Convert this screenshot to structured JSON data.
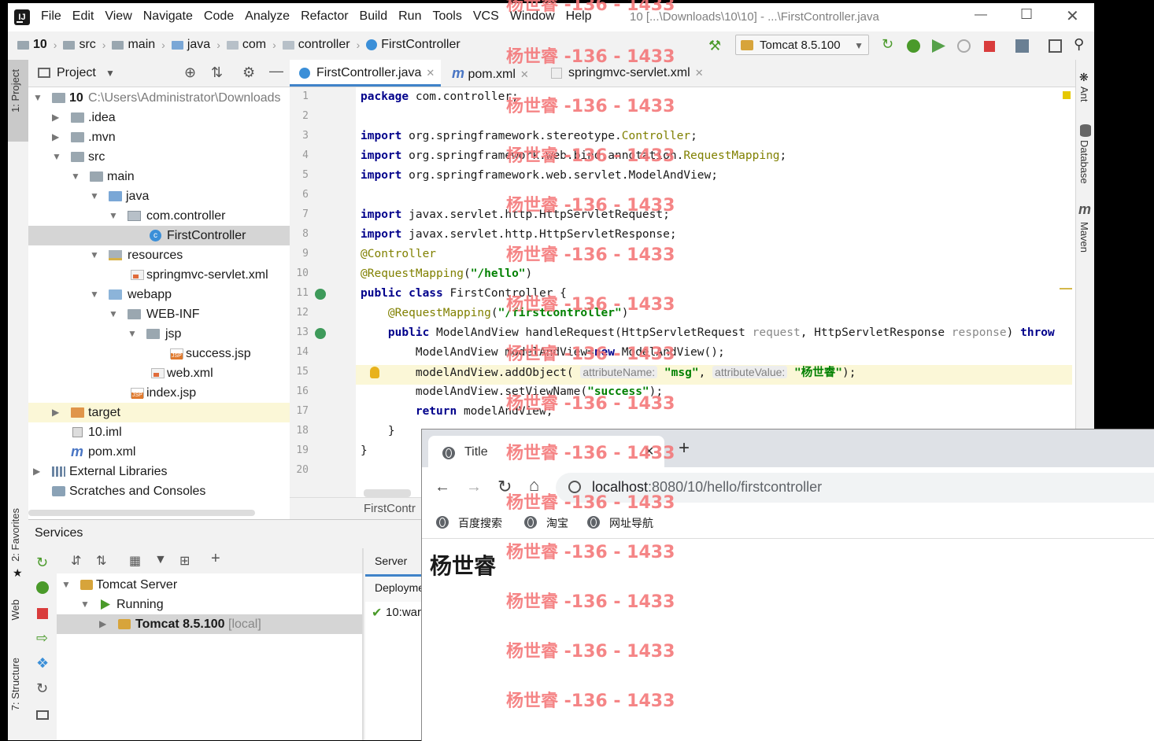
{
  "ide": {
    "menu": [
      "File",
      "Edit",
      "View",
      "Navigate",
      "Code",
      "Analyze",
      "Refactor",
      "Build",
      "Run",
      "Tools",
      "VCS",
      "Window",
      "Help"
    ],
    "window_title": "10 [...\\Downloads\\10\\10] - ...\\FirstController.java",
    "breadcrumb": [
      "10",
      "src",
      "main",
      "java",
      "com",
      "controller",
      "FirstController"
    ],
    "run_config": "Tomcat 8.5.100",
    "project_panel": {
      "title": "Project",
      "root_name": "10",
      "root_path": "C:\\Users\\Administrator\\Downloads",
      "items": [
        ".idea",
        ".mvn",
        "src",
        "main",
        "java",
        "com.controller",
        "FirstController",
        "resources",
        "springmvc-servlet.xml",
        "webapp",
        "WEB-INF",
        "jsp",
        "success.jsp",
        "web.xml",
        "index.jsp",
        "target",
        "10.iml",
        "pom.xml",
        "External Libraries",
        "Scratches and Consoles"
      ]
    },
    "editor_tabs": [
      "FirstController.java",
      "pom.xml",
      "springmvc-servlet.xml"
    ],
    "code": {
      "line_numbers": [
        "1",
        "2",
        "3",
        "4",
        "5",
        "6",
        "7",
        "8",
        "9",
        "10",
        "11",
        "12",
        "13",
        "14",
        "15",
        "16",
        "17",
        "18",
        "19",
        "20"
      ],
      "l1a": "package",
      "l1b": " com.controller;",
      "l3a": "import",
      "l3b": " org.springframework.stereotype.",
      "l3c": "Controller",
      "l3d": ";",
      "l4a": "import",
      "l4b": " org.springframework.web.bind.annotation.",
      "l4c": "RequestMapping",
      "l4d": ";",
      "l5a": "import",
      "l5b": " org.springframework.web.servlet.ModelAndView;",
      "l7a": "import",
      "l7b": " javax.servlet.http.HttpServletRequest;",
      "l8a": "import",
      "l8b": " javax.servlet.http.HttpServletResponse;",
      "l9": "@Controller",
      "l10a": "@RequestMapping",
      "l10b": "(",
      "l10c": "\"/hello\"",
      "l10d": ")",
      "l11a": "public class",
      "l11b": " FirstController {",
      "l12a": "    @RequestMapping",
      "l12b": "(",
      "l12c": "\"/firstcontroller\"",
      "l12d": ")",
      "l13a": "    public",
      "l13b": " ModelAndView handleRequest(HttpServletRequest ",
      "l13c": "request",
      "l13d": ", HttpServletResponse ",
      "l13e": "response",
      "l13f": ") ",
      "l13g": "throw",
      "l14a": "        ModelAndView modelAndView=",
      "l14b": "new",
      "l14c": " ModelAndView();",
      "l15a": "        modelAndView.addObject( ",
      "l15hint1": "attributeName:",
      "l15b": " \"msg\"",
      "l15c": ", ",
      "l15hint2": "attributeValue:",
      "l15d": " \"杨世睿\"",
      "l15e": ");",
      "l16a": "        modelAndView.setViewName(",
      "l16b": "\"success\"",
      "l16c": ");",
      "l17a": "        return",
      "l17b": " modelAndView;",
      "l18": "    }",
      "l19": "}"
    },
    "editor_crumb": "FirstContr",
    "side_tabs_left": [
      "1: Project",
      "2: Favorites",
      "Web",
      "7: Structure"
    ],
    "side_tabs_right": [
      "Ant",
      "Database",
      "Maven"
    ],
    "services": {
      "title": "Services",
      "tree": [
        "Tomcat Server",
        "Running",
        "Tomcat 8.5.100"
      ],
      "tomcat_suffix": "[local]",
      "server_tab": "Server",
      "deploy_header": "Deployme",
      "deploy_item": "10:war"
    }
  },
  "browser": {
    "tab_title": "Title",
    "url_host": "localhost",
    "url_path": ":8080/10/hello/firstcontroller",
    "bookmarks": [
      "百度搜索",
      "淘宝",
      "网址导航"
    ],
    "page_heading": "杨世睿"
  },
  "watermark": "杨世睿 -136 - 1433",
  "colors": {
    "keyword": "#00008b",
    "annotation": "#808000",
    "string": "#008000",
    "watermark": "#f4787a",
    "accent": "#4083c9"
  }
}
